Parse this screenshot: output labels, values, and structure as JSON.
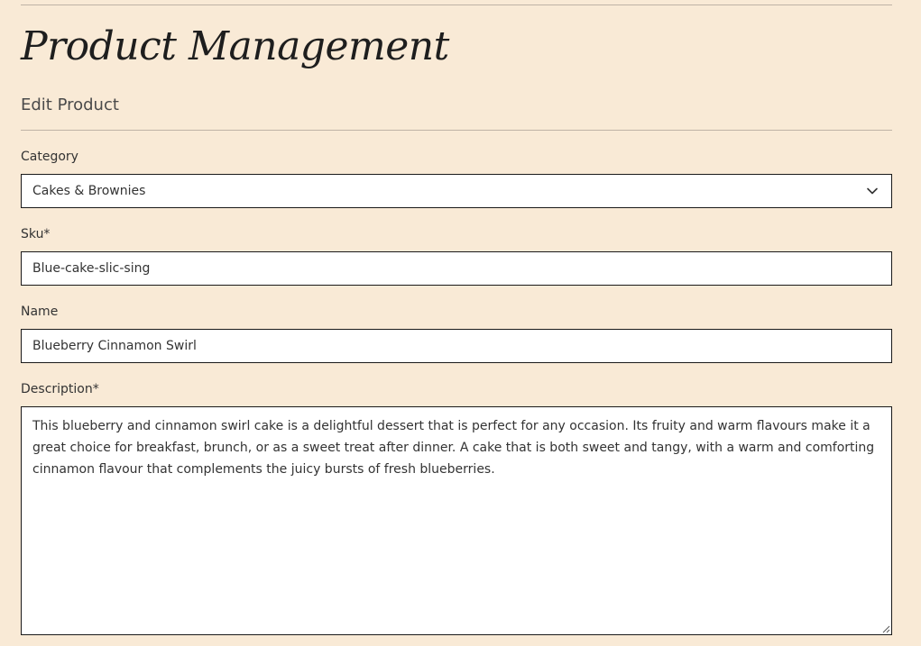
{
  "header": {
    "title": "Product Management",
    "subtitle": "Edit Product"
  },
  "form": {
    "category": {
      "label": "Category",
      "selected": "Cakes & Brownies",
      "icon": "chevron-down-icon"
    },
    "sku": {
      "label": "Sku*",
      "value": "Blue-cake-slic-sing"
    },
    "name": {
      "label": "Name",
      "value": "Blueberry Cinnamon Swirl"
    },
    "description": {
      "label": "Description*",
      "value": "This blueberry and cinnamon swirl cake is a delightful dessert that is perfect for any occasion. Its fruity and warm flavours make it a great choice for breakfast, brunch, or as a sweet treat after dinner. A cake that is both sweet and tangy, with a warm and comforting cinnamon flavour that complements the juicy bursts of fresh blueberries."
    }
  },
  "colors": {
    "background": "#f9ead6",
    "field_background": "#ffffff",
    "field_border": "#1a1a1a",
    "divider": "#bfb3a6",
    "text": "#333333"
  }
}
